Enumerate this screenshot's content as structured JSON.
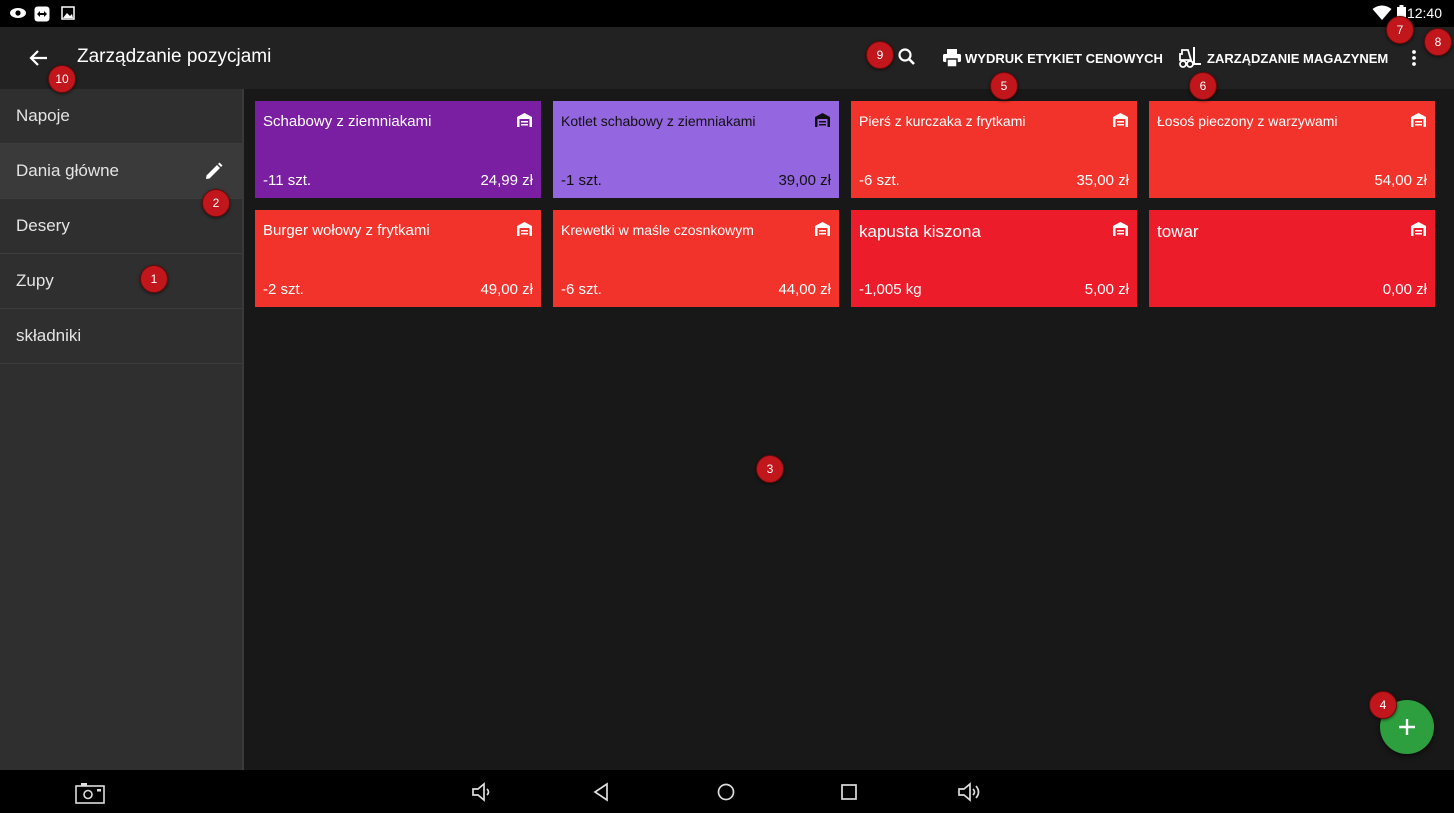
{
  "status_bar": {
    "time": "12:40",
    "icons": [
      "eye-icon",
      "teamviewer-icon",
      "image-icon",
      "wifi-icon",
      "battery-icon"
    ]
  },
  "app_bar": {
    "title": "Zarządzanie pozycjami",
    "print_labels": "WYDRUK ETYKIET CENOWYCH",
    "warehouse": "ZARZĄDZANIE MAGAZYNEM"
  },
  "sidebar": {
    "categories": [
      {
        "label": "Napoje"
      },
      {
        "label": "Dania główne",
        "active": true
      },
      {
        "label": "Desery"
      },
      {
        "label": "Zupy"
      },
      {
        "label": "składniki"
      }
    ]
  },
  "items": [
    {
      "name": "Schabowy z ziemniakami",
      "qty": "-11 szt.",
      "price": "24,99 zł",
      "color": "#7b1fa2"
    },
    {
      "name": "Kotlet schabowy z ziemniakami",
      "qty": "-1 szt.",
      "price": "39,00 zł",
      "color": "#9466e0"
    },
    {
      "name": "Pierś z kurczaka z frytkami",
      "qty": "-6 szt.",
      "price": "35,00 zł",
      "color": "#f2332b"
    },
    {
      "name": "Łosoś pieczony z warzywami",
      "qty": "",
      "price": "54,00 zł",
      "color": "#f2332b"
    },
    {
      "name": "Burger wołowy z frytkami",
      "qty": "-2 szt.",
      "price": "49,00 zł",
      "color": "#f2332b"
    },
    {
      "name": "Krewetki w maśle czosnkowym",
      "qty": "-6 szt.",
      "price": "44,00 zł",
      "color": "#f2332b"
    },
    {
      "name": "kapusta kiszona",
      "qty": "-1,005 kg",
      "price": "5,00 zł",
      "color": "#ec1c2a"
    },
    {
      "name": "towar",
      "qty": "",
      "price": "0,00 zł",
      "color": "#ec1c2a"
    }
  ],
  "annotations": [
    "1",
    "2",
    "3",
    "4",
    "5",
    "6",
    "7",
    "8",
    "9",
    "10"
  ],
  "colors": {
    "appbar": "#222222",
    "sidebar": "#2f2f2f",
    "content": "#181818",
    "fab": "#2e9f3e",
    "badge": "#c0161c"
  }
}
